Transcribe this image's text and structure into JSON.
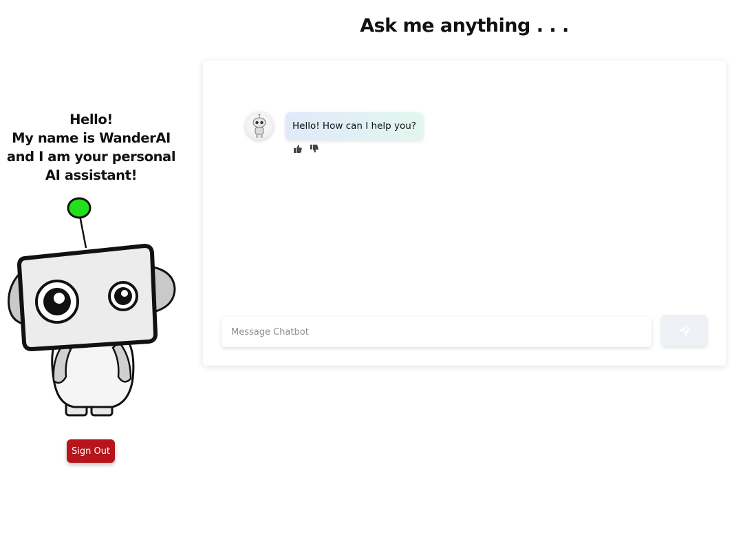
{
  "header": {
    "title": "Ask me anything . . ."
  },
  "sidebar": {
    "intro_lines": [
      "Hello!",
      "My name is WanderAI",
      "and I am your personal",
      "AI assistant!"
    ],
    "mascot_icon": "robot-mascot-icon",
    "signout_label": "Sign Out",
    "signout_color": "#b5151b"
  },
  "chat": {
    "messages": [
      {
        "sender": "bot",
        "avatar_icon": "robot-avatar-icon",
        "text": "Hello! How can I help you?",
        "feedback_icons": [
          "thumbs-up-icon",
          "thumbs-down-icon"
        ]
      }
    ],
    "input": {
      "value": "",
      "placeholder": "Message Chatbot"
    },
    "send_icon": "send-icon"
  },
  "colors": {
    "accent_green": "#22e01c",
    "bubble_gradient_start": "#dfe9fb",
    "bubble_gradient_end": "#e2f7ee"
  }
}
